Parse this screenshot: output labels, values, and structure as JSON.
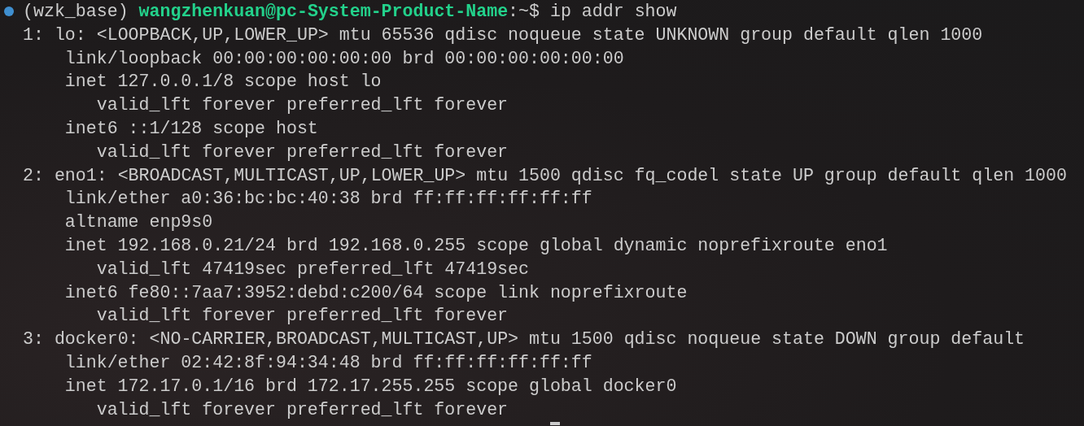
{
  "prompt": {
    "env": "(wzk_base)",
    "user_host": "wangzhenkuan@pc-System-Product-Name",
    "path": ":~$",
    "command": "ip addr show"
  },
  "output": [
    {
      "text": "1: lo: <LOOPBACK,UP,LOWER_UP> mtu 65536 qdisc noqueue state UNKNOWN group default qlen 1000",
      "children": [
        {
          "text": "link/loopback 00:00:00:00:00:00 brd 00:00:00:00:00:00"
        },
        {
          "text": "inet 127.0.0.1/8 scope host lo",
          "children": [
            {
              "text": "valid_lft forever preferred_lft forever"
            }
          ]
        },
        {
          "text": "inet6 ::1/128 scope host",
          "children": [
            {
              "text": "valid_lft forever preferred_lft forever"
            }
          ]
        }
      ]
    },
    {
      "text": "2: eno1: <BROADCAST,MULTICAST,UP,LOWER_UP> mtu 1500 qdisc fq_codel state UP group default qlen 1000",
      "children": [
        {
          "text": "link/ether a0:36:bc:bc:40:38 brd ff:ff:ff:ff:ff:ff"
        },
        {
          "text": "altname enp9s0"
        },
        {
          "text": "inet 192.168.0.21/24 brd 192.168.0.255 scope global dynamic noprefixroute eno1",
          "children": [
            {
              "text": "valid_lft 47419sec preferred_lft 47419sec"
            }
          ]
        },
        {
          "text": "inet6 fe80::7aa7:3952:debd:c200/64 scope link noprefixroute",
          "children": [
            {
              "text": "valid_lft forever preferred_lft forever"
            }
          ]
        }
      ]
    },
    {
      "text": "3: docker0: <NO-CARRIER,BROADCAST,MULTICAST,UP> mtu 1500 qdisc noqueue state DOWN group default",
      "children": [
        {
          "text": "link/ether 02:42:8f:94:34:48 brd ff:ff:ff:ff:ff:ff"
        },
        {
          "text": "inet 172.17.0.1/16 brd 172.17.255.255 scope global docker0",
          "children": [
            {
              "text": "valid_lft forever preferred_lft forever"
            }
          ]
        }
      ]
    }
  ]
}
